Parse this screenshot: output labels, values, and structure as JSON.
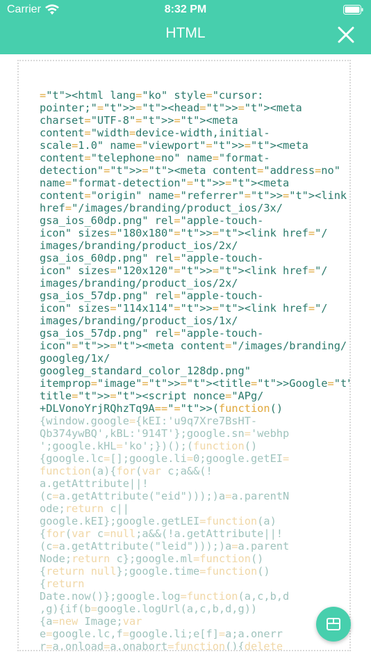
{
  "status_bar": {
    "carrier": "Carrier",
    "time": "8:32 PM"
  },
  "nav": {
    "title": "HTML",
    "close_icon": "close-icon"
  },
  "colors": {
    "accent": "#47cfad",
    "code_tag": "#e0a83c",
    "code_text": "#2b7a6c"
  },
  "code_lines": [
    "<html lang=\"ko\" style=\"cursor:",
    "pointer;\"><head><meta",
    "charset=\"UTF-8\"><meta",
    "content=\"width=device-width,initial-",
    "scale=1.0\" name=\"viewport\"><meta",
    "content=\"telephone=no\" name=\"format-",
    "detection\"><meta content=\"address=no\"",
    "name=\"format-detection\"><meta",
    "content=\"origin\" name=\"referrer\"><link",
    "href=\"/images/branding/product_ios/3x/",
    "gsa_ios_60dp.png\" rel=\"apple-touch-",
    "icon\" sizes=\"180x180\"><link href=\"/",
    "images/branding/product_ios/2x/",
    "gsa_ios_60dp.png\" rel=\"apple-touch-",
    "icon\" sizes=\"120x120\"><link href=\"/",
    "images/branding/product_ios/2x/",
    "gsa_ios_57dp.png\" rel=\"apple-touch-",
    "icon\" sizes=\"114x114\"><link href=\"/",
    "images/branding/product_ios/1x/",
    "gsa_ios_57dp.png\" rel=\"apple-touch-",
    "icon\"><meta content=\"/images/branding/",
    "googleg/1x/",
    "googleg_standard_color_128dp.png\"",
    "itemprop=\"image\"><title>Google</",
    "title><script nonce=\"APg/",
    "+DLVonoYrjRQhzTq9A==\">(function()",
    "{window.google={kEI:'u9q7Xre7BsHT-",
    "Qb374ywBQ',kBL:'914T'};google.sn='webhp",
    "';google.kHL='ko';})();(function()",
    "{google.lc=[];google.li=0;google.getEI=",
    "function(a){for(var c;a&&(!",
    "a.getAttribute||!",
    "(c=a.getAttribute(\"eid\")));)a=a.parentN",
    "ode;return c||",
    "google.kEI};google.getLEI=function(a)",
    "{for(var c=null;a&&(!a.getAttribute||!",
    "(c=a.getAttribute(\"leid\")));)a=a.parent",
    "Node;return c};google.ml=function()",
    "{return null};google.time=function()",
    "{return",
    "Date.now()};google.log=function(a,c,b,d",
    ",g){if(b=google.logUrl(a,c,b,d,g))",
    "{a=new Image;var",
    "e=google.lc,f=google.li;e[f]=a;a.onerr",
    "r=a.onload=a.onabort=function(){delete"
  ],
  "fab": {
    "icon": "box-icon"
  }
}
